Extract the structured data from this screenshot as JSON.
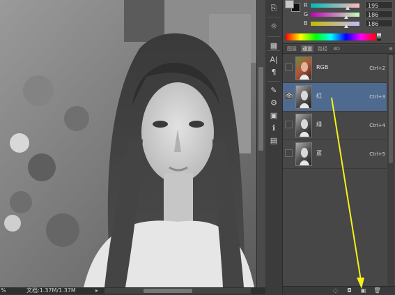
{
  "status": {
    "zoom": "%",
    "doc_info": "文档:1.37M/1.37M",
    "arrow": "▸"
  },
  "color": {
    "fg": "#c8c8c8",
    "bg": "#111111",
    "sliders": [
      {
        "label": "R",
        "value": "195",
        "fraction": 0.76,
        "gradient": "linear-gradient(to right,#00baba,#ffbaba)"
      },
      {
        "label": "G",
        "value": "186",
        "fraction": 0.73,
        "gradient": "linear-gradient(to right,#c300ba,#c3ffba)"
      },
      {
        "label": "B",
        "value": "186",
        "fraction": 0.73,
        "gradient": "linear-gradient(to right,#c3ba00,#c3baff)"
      }
    ]
  },
  "tabs": [
    {
      "label": "图层",
      "active": false
    },
    {
      "label": "通道",
      "active": true
    },
    {
      "label": "路径",
      "active": false
    },
    {
      "label": "3D",
      "active": false
    }
  ],
  "tab_menu_icon": "panel-menu-icon",
  "channels": [
    {
      "name": "RGB",
      "shortcut": "Ctrl+2",
      "visible": false,
      "selected": false,
      "thumb": "color"
    },
    {
      "name": "红",
      "shortcut": "Ctrl+3",
      "visible": true,
      "selected": true,
      "thumb": "gray"
    },
    {
      "name": "绿",
      "shortcut": "Ctrl+4",
      "visible": false,
      "selected": false,
      "thumb": "gray"
    },
    {
      "name": "蓝",
      "shortcut": "Ctrl+5",
      "visible": false,
      "selected": false,
      "thumb": "gray"
    }
  ],
  "tools": [
    {
      "name": "history-icon",
      "glyph": "⎘"
    },
    {
      "name": "adjust-icon",
      "glyph": "☼"
    },
    {
      "name": "styles-icon",
      "glyph": "▦"
    },
    {
      "name": "character-icon",
      "glyph": "A|"
    },
    {
      "name": "paragraph-icon",
      "glyph": "¶"
    },
    {
      "name": "brush-icon",
      "glyph": "✎"
    },
    {
      "name": "tool-presets-icon",
      "glyph": "⚙"
    },
    {
      "name": "navigator-icon",
      "glyph": "▣"
    },
    {
      "name": "info-icon",
      "glyph": "ℹ"
    },
    {
      "name": "notes-icon",
      "glyph": "▤"
    }
  ],
  "bottom_icons": [
    {
      "name": "load-selection-icon",
      "glyph": "◌"
    },
    {
      "name": "save-selection-icon",
      "glyph": "◘"
    },
    {
      "name": "new-channel-icon",
      "glyph": "▣"
    },
    {
      "name": "delete-channel-icon",
      "glyph": "🗑"
    }
  ],
  "annotation_color": "#f6f21a"
}
